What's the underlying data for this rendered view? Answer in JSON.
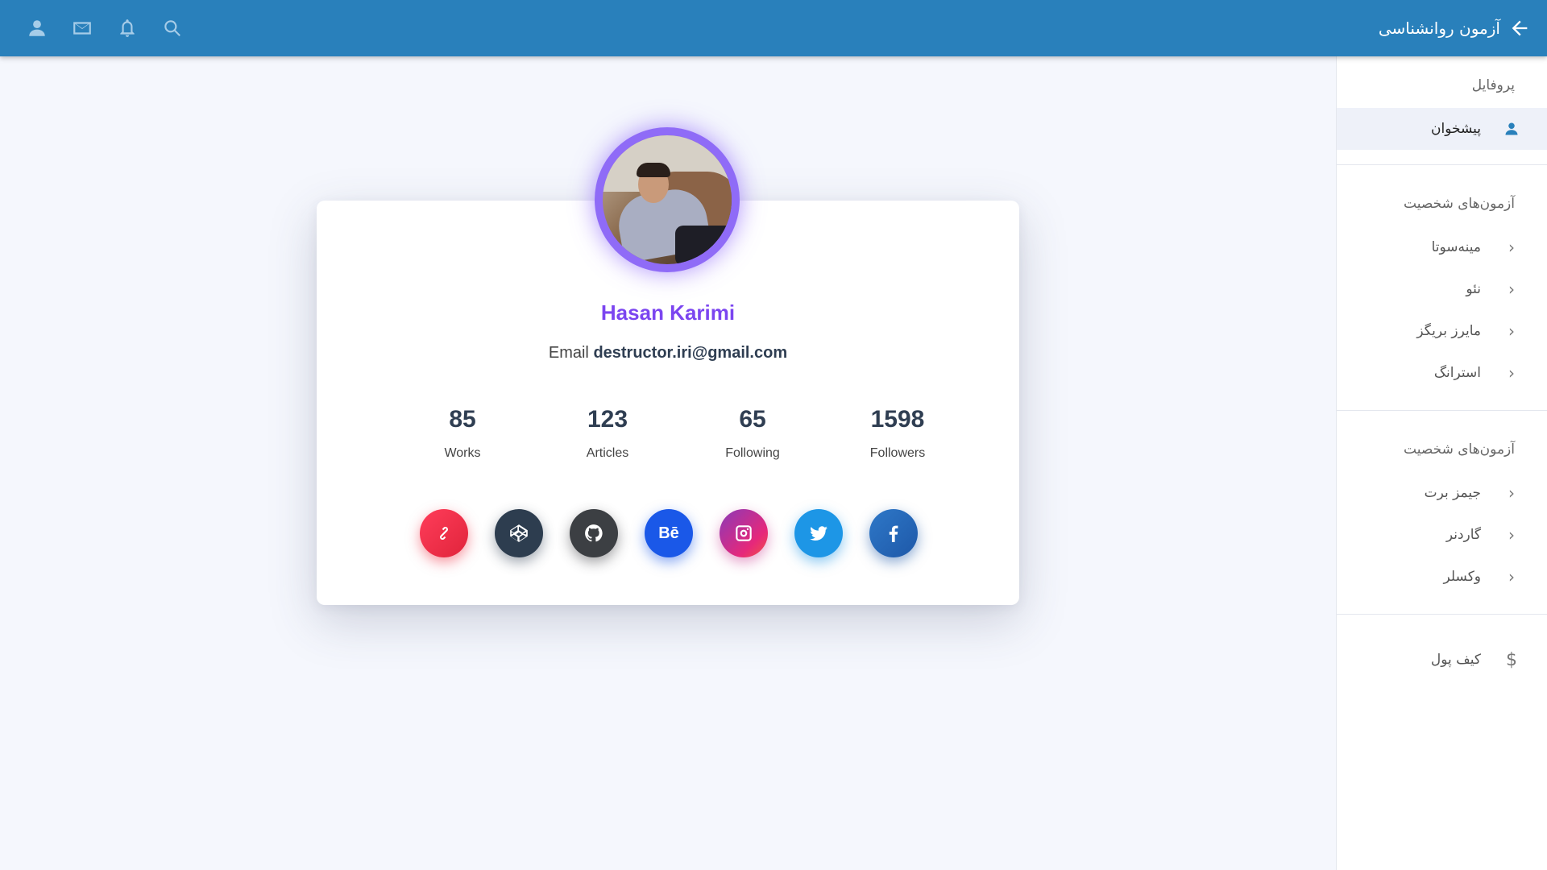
{
  "header": {
    "title": "آزمون روانشناسی",
    "icons": [
      "user-icon",
      "mail-icon",
      "bell-icon",
      "search-icon"
    ]
  },
  "sidebar": {
    "profile_header": "پروفایل",
    "dashboard_label": "پیشخوان",
    "section1_header": "آزمون‌های شخصیت",
    "section1_items": [
      {
        "label": "مینه‌سوتا"
      },
      {
        "label": "نئو"
      },
      {
        "label": "مایرز بریگز"
      },
      {
        "label": "استرانگ"
      }
    ],
    "section2_header": "آزمون‌های شخصیت",
    "section2_items": [
      {
        "label": "جیمز برت"
      },
      {
        "label": "گاردنر"
      },
      {
        "label": "وکسلر"
      }
    ],
    "wallet_label": "کیف پول",
    "wallet_symbol": "$"
  },
  "profile": {
    "name": "Hasan Karimi",
    "email_label": "Email",
    "email": "destructor.iri@gmail.com",
    "stats": [
      {
        "value": "85",
        "label": "Works"
      },
      {
        "value": "123",
        "label": "Articles"
      },
      {
        "value": "65",
        "label": "Following"
      },
      {
        "value": "1598",
        "label": "Followers"
      }
    ],
    "socials": [
      {
        "name": "link-icon",
        "color": "#e9283f"
      },
      {
        "name": "codepen-icon",
        "color": "#2d3d4f"
      },
      {
        "name": "github-icon",
        "color": "#3c3f43"
      },
      {
        "name": "behance-icon",
        "text": "Bē",
        "color": "#1a58e8"
      },
      {
        "name": "instagram-icon",
        "color": "#c13584"
      },
      {
        "name": "twitter-icon",
        "color": "#1d96e6"
      },
      {
        "name": "facebook-icon",
        "color": "#2466b8"
      }
    ]
  },
  "colors": {
    "topbar": "#2980bb",
    "accent_name": "#7b45f0",
    "avatar_ring": "#8f6bf7",
    "background": "#f5f7fd"
  }
}
